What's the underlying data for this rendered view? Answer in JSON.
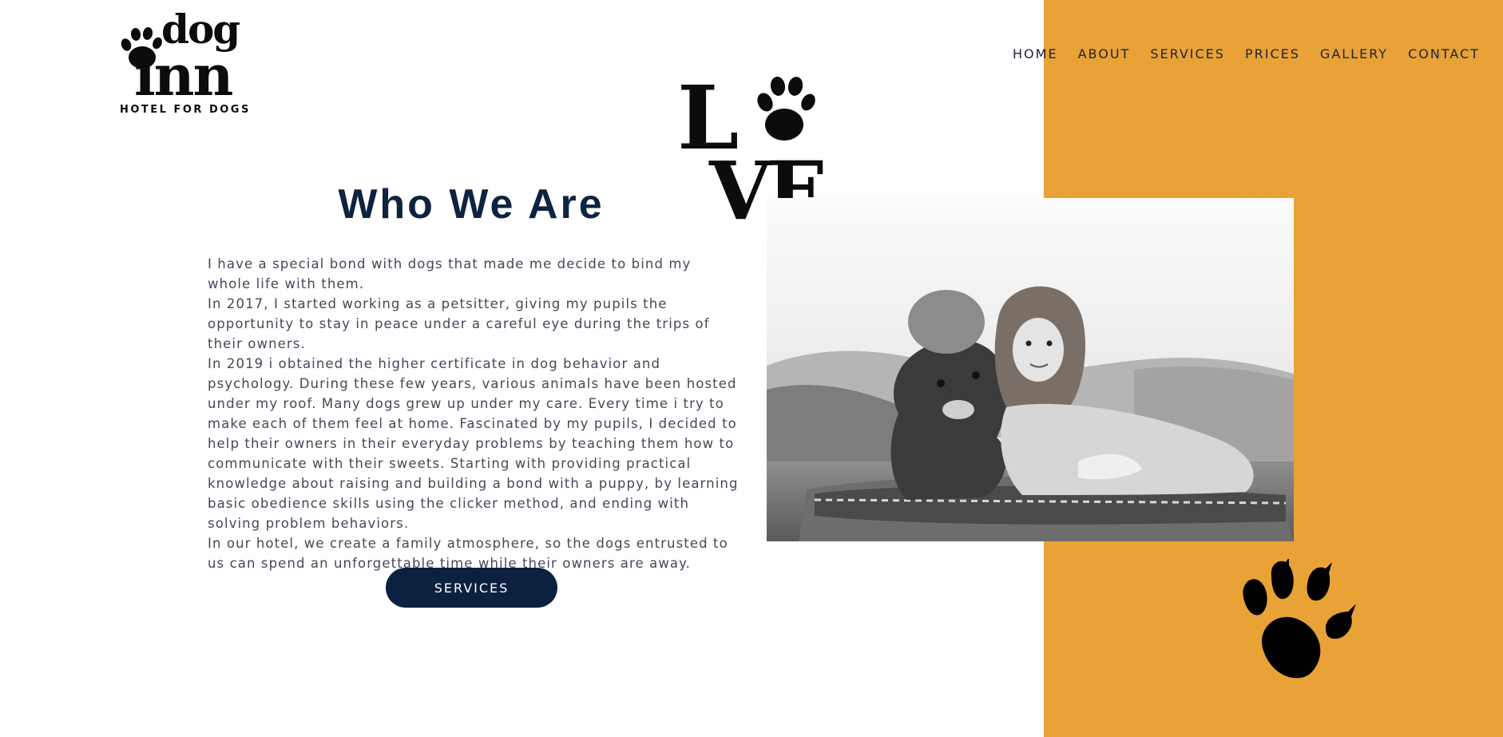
{
  "colors": {
    "accent_orange": "#e9a236",
    "navy": "#0c213f",
    "text": "#424957",
    "background": "#ffffff"
  },
  "logo": {
    "line1": "dog",
    "line2": "inn",
    "tagline": "HOTEL FOR DOGS",
    "icon": "paw-icon"
  },
  "nav": {
    "items": [
      {
        "label": "HOME"
      },
      {
        "label": "ABOUT"
      },
      {
        "label": "SERVICES"
      },
      {
        "label": "PRICES"
      },
      {
        "label": "GALLERY"
      },
      {
        "label": "CONTACT"
      }
    ]
  },
  "love_graphic": {
    "letters": [
      "L",
      "V",
      "E"
    ],
    "icon": "paw-icon"
  },
  "about": {
    "title": "Who We Are",
    "paragraphs": [
      "I have a special bond with dogs that made me decide to bind my whole life with them.",
      "In 2017, I started working as a petsitter, giving my pupils the opportunity to stay in peace under a careful eye during the trips of their owners.",
      "In 2019 i obtained the higher certificate in dog behavior and psychology. During these few years, various animals have been hosted under my roof. Many dogs grew up under my care. Every time i try to make each of them feel at home. Fascinated by my pupils, I decided to help their owners in their everyday problems by teaching them how to communicate with their sweets. Starting with providing practical knowledge about raising and building a bond with a puppy, by learning basic obedience skills using the clicker method, and ending with solving problem behaviors.",
      "In our hotel, we create a family atmosphere, so the dogs entrusted to us can spend an unforgettable time while their owners are away."
    ],
    "button_label": "SERVICES"
  },
  "decor": {
    "big_paw_icon": "paw-icon",
    "photo": "woman-and-dog-photo"
  }
}
